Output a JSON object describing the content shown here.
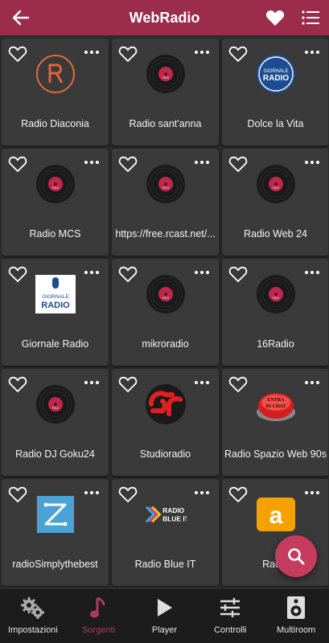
{
  "header": {
    "title": "WebRadio",
    "back_icon": "back-arrow-icon",
    "favorites_icon": "heart-icon",
    "list_icon": "list-icon",
    "color": "#9b2c4c"
  },
  "stations": [
    {
      "name": "Radio Diaconia",
      "logo": "diaconia"
    },
    {
      "name": "Radio sant'anna",
      "logo": "vinyl"
    },
    {
      "name": "Dolce la Vita",
      "logo": "giornale-round"
    },
    {
      "name": "Radio MCS",
      "logo": "vinyl"
    },
    {
      "name": "https://free.rcast.net/...",
      "logo": "vinyl"
    },
    {
      "name": "Radio Web 24",
      "logo": "vinyl"
    },
    {
      "name": "Giornale Radio",
      "logo": "giornale-square"
    },
    {
      "name": "mikroradio",
      "logo": "vinyl"
    },
    {
      "name": "16Radio",
      "logo": "vinyl"
    },
    {
      "name": "Radio DJ Goku24",
      "logo": "vinyl"
    },
    {
      "name": "Studioradio",
      "logo": "sr"
    },
    {
      "name": "Radio Spazio Web 90s",
      "logo": "chat-button"
    },
    {
      "name": "radioSimplythebest",
      "logo": "z-blue"
    },
    {
      "name": "Radio Blue IT",
      "logo": "radio-blue"
    },
    {
      "name": "Radio",
      "logo": "orange-a"
    }
  ],
  "logo_text": {
    "vinyl_label": "FOLK",
    "giornale_top": "GIORNALE",
    "giornale_bottom": "RADIO",
    "chat_line1": "ENTRA",
    "chat_line2": "IN CHAT",
    "radio_blue_line1": "RADIO",
    "radio_blue_line2": "BLUE IT"
  },
  "fab": {
    "icon": "search-icon",
    "color": "#c53c5f"
  },
  "nav": [
    {
      "label": "Impostazioni",
      "icon": "gears-icon",
      "active": false
    },
    {
      "label": "Sorgenti",
      "icon": "music-note-icon",
      "active": true
    },
    {
      "label": "Player",
      "icon": "play-icon",
      "active": false
    },
    {
      "label": "Controlli",
      "icon": "sliders-icon",
      "active": false
    },
    {
      "label": "Multiroom",
      "icon": "speaker-icon",
      "active": false
    }
  ],
  "accent_color": "#b03a5b"
}
